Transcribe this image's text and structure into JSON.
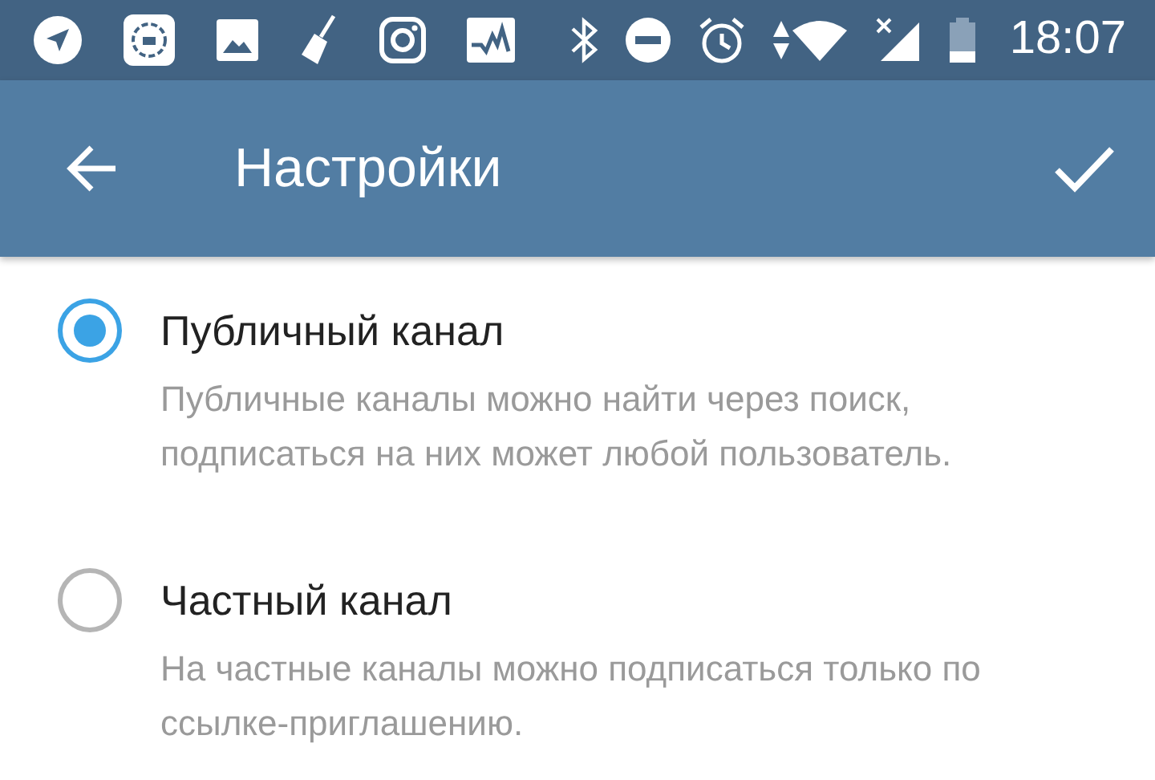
{
  "status_bar": {
    "time": "18:07"
  },
  "app_bar": {
    "title": "Настройки"
  },
  "options": [
    {
      "title": "Публичный канал",
      "description": "Публичные каналы можно найти через поиск, подписаться на них может любой пользователь.",
      "selected": true
    },
    {
      "title": "Частный канал",
      "description": "На частные каналы можно подписаться только по ссылке-приглашению.",
      "selected": false
    }
  ]
}
